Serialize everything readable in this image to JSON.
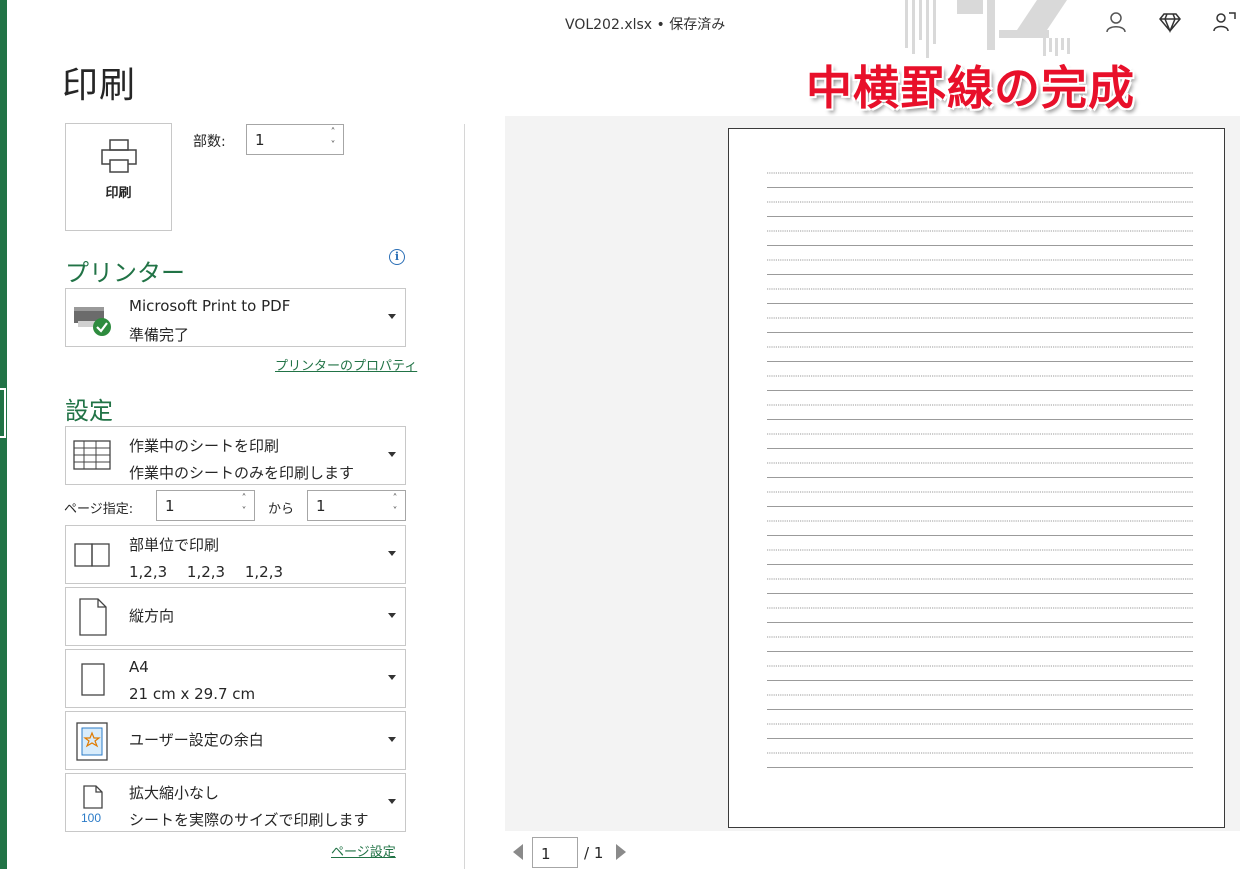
{
  "titlebar": {
    "doc_title": "VOL202.xlsx • 保存済み"
  },
  "page_title": "印刷",
  "banner": "中横罫線の完成",
  "print_button": {
    "label": "印刷"
  },
  "copies": {
    "label": "部数:",
    "value": "1"
  },
  "printer": {
    "section_title": "プリンター",
    "name": "Microsoft Print to PDF",
    "status": "準備完了",
    "properties_link": "プリンターのプロパティ"
  },
  "settings": {
    "section_title": "設定",
    "scope": {
      "title": "作業中のシートを印刷",
      "subtitle": "作業中のシートのみを印刷します"
    },
    "pages": {
      "label": "ページ指定:",
      "from": "1",
      "to_label": "から",
      "to": "1"
    },
    "collate": {
      "title": "部単位で印刷",
      "subtitle": "1,2,3　 1,2,3　 1,2,3"
    },
    "orientation": {
      "title": "縦方向"
    },
    "paper": {
      "title": "A4",
      "subtitle": "21 cm x 29.7 cm"
    },
    "margins": {
      "title": "ユーザー設定の余白"
    },
    "scaling": {
      "title": "拡大縮小なし",
      "subtitle": "シートを実際のサイズで印刷します",
      "icon_text": "100"
    },
    "page_setup_link": "ページ設定"
  },
  "preview_nav": {
    "current_page": "1",
    "total": "/ 1"
  },
  "colors": {
    "accent": "#217346",
    "banner": "#e8102a",
    "link": "#217346"
  }
}
